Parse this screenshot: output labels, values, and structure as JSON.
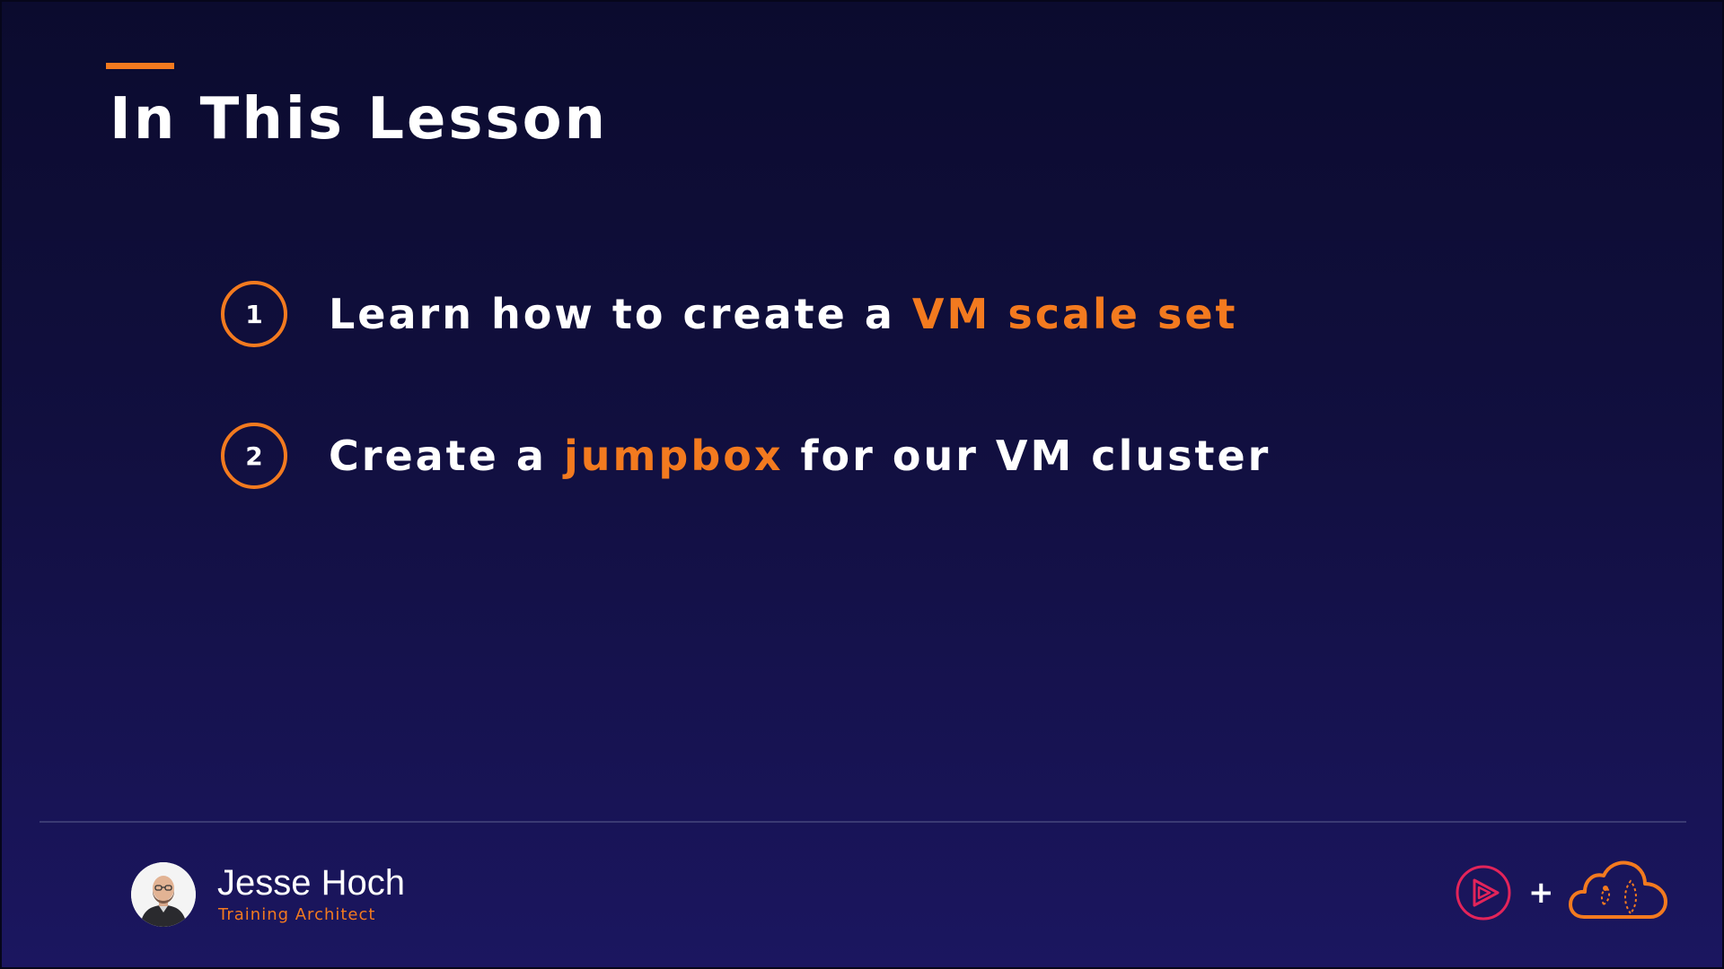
{
  "slide": {
    "title": "In This Lesson",
    "colors": {
      "accent": "#f37a1f",
      "background_top": "#0b0b2e",
      "background_bottom": "#1b1660",
      "text": "#ffffff"
    },
    "items": [
      {
        "number": "1",
        "text_before": "Learn how to create a ",
        "highlight": "VM scale set",
        "text_after": ""
      },
      {
        "number": "2",
        "text_before": "Create a ",
        "highlight": "jumpbox",
        "text_after": " for our VM cluster"
      }
    ]
  },
  "presenter": {
    "name": "Jesse Hoch",
    "role": "Training Architect",
    "avatar_icon": "presenter-photo"
  },
  "branding": {
    "play_logo_icon": "pluralsight-play-icon",
    "plus_symbol": "+",
    "cloud_logo_icon": "acloudguru-cloud-icon",
    "play_logo_color": "#e3245a"
  }
}
